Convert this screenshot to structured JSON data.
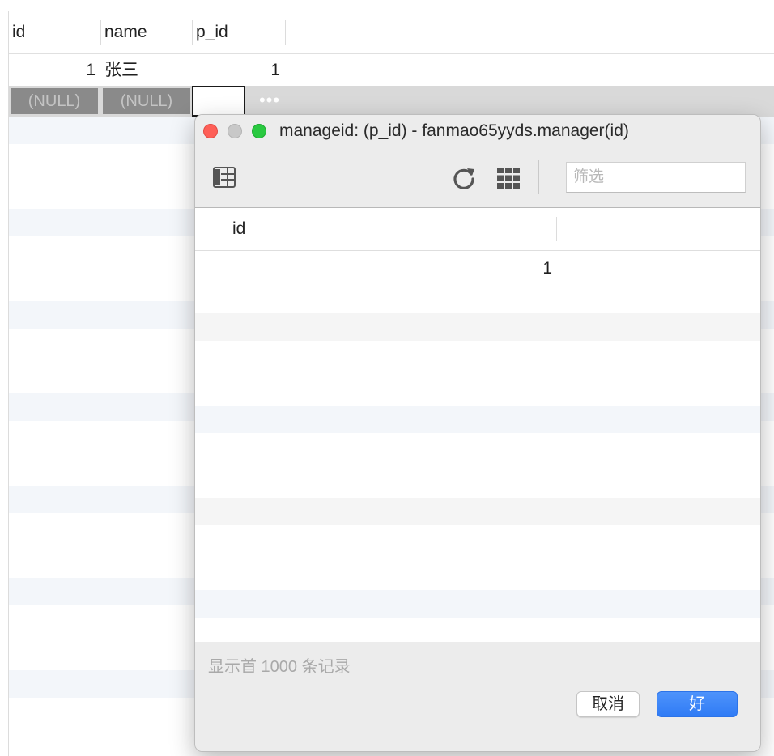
{
  "grid": {
    "columns": [
      "id",
      "name",
      "p_id"
    ],
    "rows": [
      {
        "id": "1",
        "name": "张三",
        "p_id": "1"
      }
    ],
    "selected_row": {
      "id": "(NULL)",
      "name": "(NULL)",
      "p_id": "",
      "more": "•••"
    }
  },
  "dialog": {
    "title": "manageid: (p_id) - fanmao65yyds.manager(id)",
    "filter_placeholder": "筛选",
    "table": {
      "columns": [
        "id"
      ],
      "rows": [
        {
          "id": "1"
        }
      ]
    },
    "record_note": "显示首 1000 条记录",
    "cancel_label": "取消",
    "ok_label": "好"
  },
  "icons": {
    "toolbar_left": "columns-view-icon",
    "refresh": "refresh-icon",
    "grid": "grid-view-icon"
  },
  "colors": {
    "close": "#fe5f57",
    "minimize": "#c8c8c8",
    "maximize": "#29c940",
    "accent": "#2f7bf5"
  }
}
